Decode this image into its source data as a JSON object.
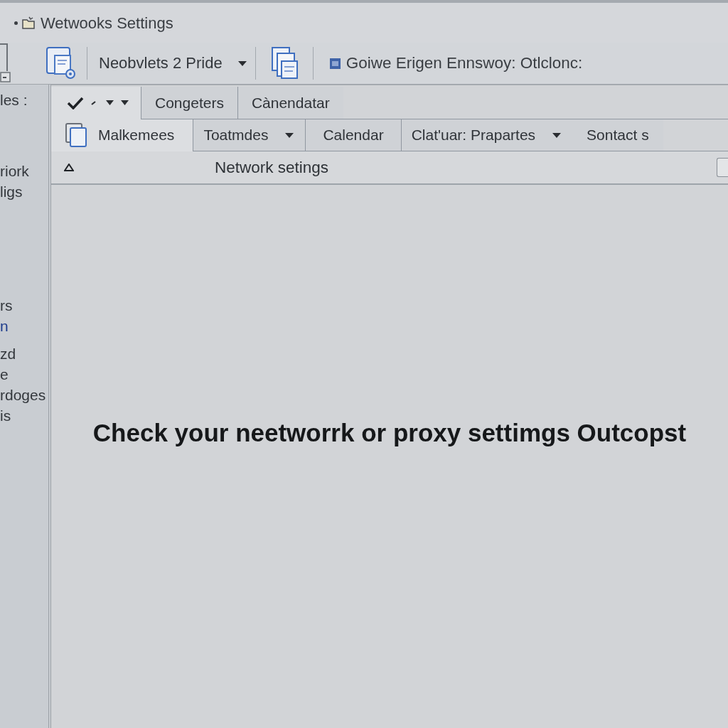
{
  "window": {
    "title": "Wetwooks Settings"
  },
  "toolbar": {
    "dropdown": {
      "label": "Neobvlets 2 Pride"
    },
    "status": "Goiwe Erigen Ennswoy: Otlclonc:"
  },
  "sidebar": {
    "groups": [
      [
        {
          "label": "les :",
          "kind": "text"
        }
      ],
      [
        {
          "label": "riork",
          "kind": "text"
        },
        {
          "label": "ligs",
          "kind": "text"
        }
      ],
      [
        {
          "label": "rs",
          "kind": "text"
        },
        {
          "label": "n",
          "kind": "link"
        }
      ],
      [
        {
          "label": "zd",
          "kind": "text"
        },
        {
          "label": "e",
          "kind": "text"
        },
        {
          "label": "rdoges",
          "kind": "text"
        },
        {
          "label": "is",
          "kind": "text"
        }
      ]
    ]
  },
  "tab_rows": [
    [
      {
        "kind": "icons",
        "selected": true
      },
      {
        "kind": "text",
        "label": "Congeters",
        "selected": false
      },
      {
        "kind": "text",
        "label": "Cànendatar",
        "selected": false
      }
    ],
    [
      {
        "kind": "icon_text",
        "label": "Malkemees",
        "selected": true
      },
      {
        "kind": "dropdown",
        "label": "Toatmdes",
        "selected": false
      },
      {
        "kind": "text",
        "label": "Calendar",
        "selected": false
      },
      {
        "kind": "dropdown",
        "label": "Clat'uar: Prapartes",
        "selected": false
      },
      {
        "kind": "link",
        "label": "Sontact s",
        "selected": false
      }
    ]
  ],
  "section_header": {
    "label": "Network setings"
  },
  "message": "Check your neetworrk or proxy settimgs Outcopst"
}
